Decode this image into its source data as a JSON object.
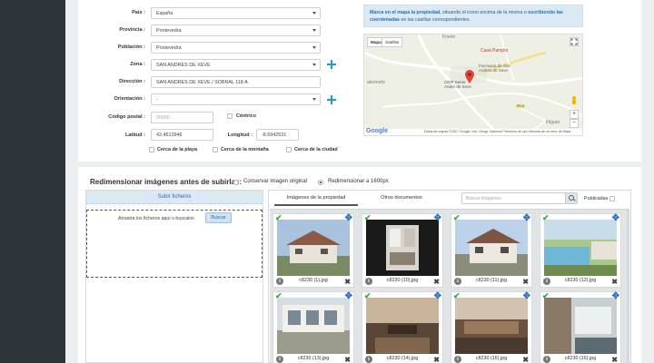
{
  "form": {
    "pais": {
      "label": "País :",
      "value": "España"
    },
    "provincia": {
      "label": "Provincia :",
      "value": "Pontevedra"
    },
    "poblacion": {
      "label": "Población :",
      "value": "Pontevedra"
    },
    "zona": {
      "label": "Zona :",
      "value": "SAN ANDRES DE XEVE"
    },
    "direccion": {
      "label": "Dirección :",
      "value": "SAN ANDRES DE XEVE / SOBRAL 118 A"
    },
    "orientacion": {
      "label": "Orientación :",
      "value": "-"
    },
    "codigo_postal": {
      "label": "Código postal :",
      "placeholder": "00000"
    },
    "centrico": {
      "label": "Céntrico"
    },
    "latitud": {
      "label": "Latitud :",
      "value": "42.4613946"
    },
    "longitud": {
      "label": "Longitud :",
      "value": "-8.5942531"
    },
    "cerca_playa": "Cerca de la playa",
    "cerca_montana": "Cerca de la montaña",
    "cerca_ciudad": "Cerca de la ciudad"
  },
  "info": {
    "part1": "Marca en el mapa la propiedad,",
    "bold1": " situando el icono",
    "part2": " encima de la misma o ",
    "bold2": "escribiendo las coordenadas",
    "part3": " en las casillas correspondientes."
  },
  "map": {
    "tab_map": "Mapa",
    "tab_sat": "Satélite",
    "labels": {
      "casa_pampin": "Casa Pampín",
      "parroquia": "Parroquia de San\nAndrés de Xeve",
      "ceip": "CEIP Santo\nAndré de Xeve",
      "atomorto": "atomorto",
      "filguer": "Filguer",
      "frieiro": "Frieiro",
      "pr_k": "PR-K"
    },
    "footer": "Datos de mapas ©2017 Google, Inst. Geogr. Nacional   Términos de uso   Informar de un error de Maps",
    "google": "Google"
  },
  "resize": {
    "title": "Redimensionar imágenes antes de subirlas:",
    "opt1": "Conservar imagen original",
    "opt2": "Redimensionar a 1600px"
  },
  "upload": {
    "header": "Subir ficheros",
    "drop_text": "Arrastra los ficheros aquí o buscalos",
    "button": "Buscar"
  },
  "gallery": {
    "tab_images": "Imágenes de la propiedad",
    "tab_docs": "Otros documentos",
    "search_placeholder": "Buscar imágenes",
    "published": "Publicadas",
    "files": [
      "c8230 (1).jpg",
      "c8230 (10).jpg",
      "c8230 (11).jpg",
      "c8230 (12).jpg",
      "c8230 (13).jpg",
      "c8230 (14).jpg",
      "c8230 (15).jpg",
      "c8230 (16).jpg"
    ]
  }
}
